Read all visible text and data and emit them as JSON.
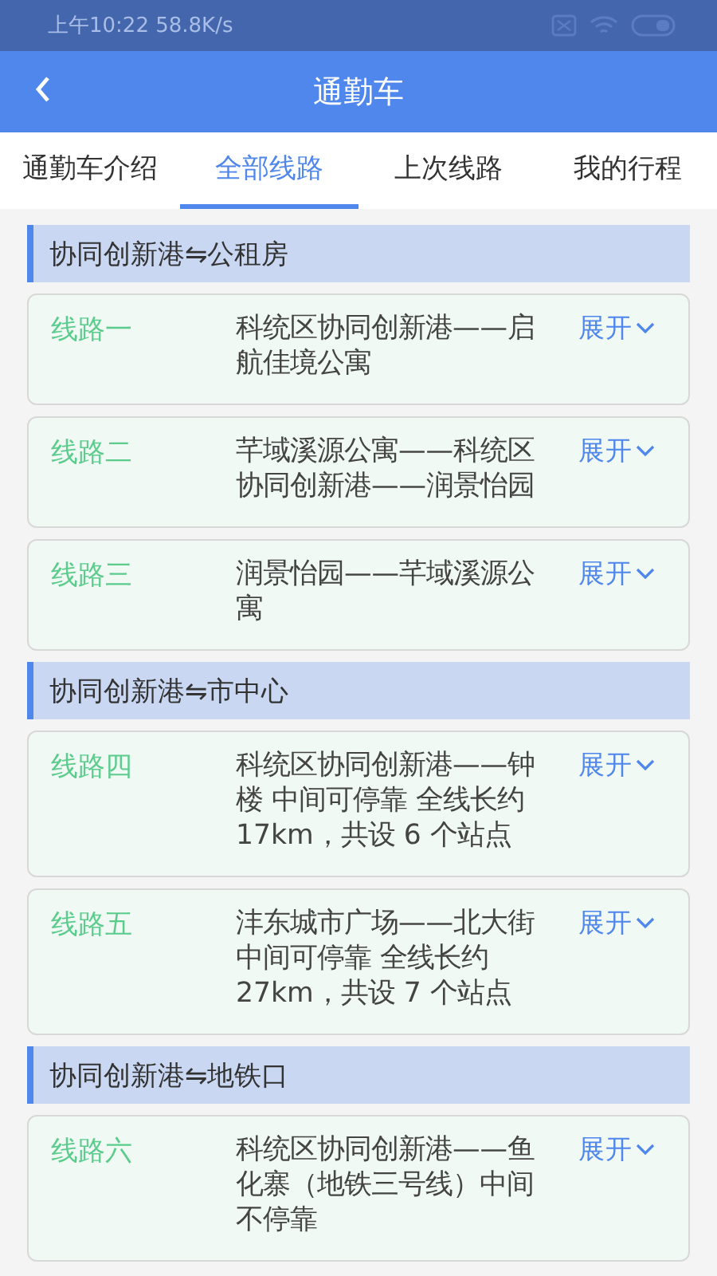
{
  "status_bar": {
    "time": "上午10:22 58.8K/s"
  },
  "header": {
    "title": "通勤车"
  },
  "tabs": [
    {
      "label": "通勤车介绍",
      "selected": false
    },
    {
      "label": "全部线路",
      "selected": true
    },
    {
      "label": "上次线路",
      "selected": false
    },
    {
      "label": "我的行程",
      "selected": false
    }
  ],
  "groups": [
    {
      "title": "协同创新港⇋公租房",
      "routes": [
        {
          "name": "线路一",
          "description": "科统区协同创新港——启航佳境公寓",
          "toggle": "展开"
        },
        {
          "name": "线路二",
          "description": "芊域溪源公寓——科统区协同创新港——润景怡园",
          "toggle": "展开"
        },
        {
          "name": "线路三",
          "description": "润景怡园——芊域溪源公寓",
          "toggle": "展开"
        }
      ]
    },
    {
      "title": "协同创新港⇋市中心",
      "routes": [
        {
          "name": "线路四",
          "description": "科统区协同创新港——钟楼 中间可停靠 全线长约17km，共设 6 个站点",
          "toggle": "展开"
        },
        {
          "name": "线路五",
          "description": "沣东城市广场——北大街中间可停靠 全线长约27km，共设 7 个站点",
          "toggle": "展开"
        }
      ]
    },
    {
      "title": "协同创新港⇋地铁口",
      "routes": [
        {
          "name": "线路六",
          "description": "科统区协同创新港——鱼化寨（地铁三号线）中间不停靠",
          "toggle": "展开"
        }
      ]
    }
  ]
}
